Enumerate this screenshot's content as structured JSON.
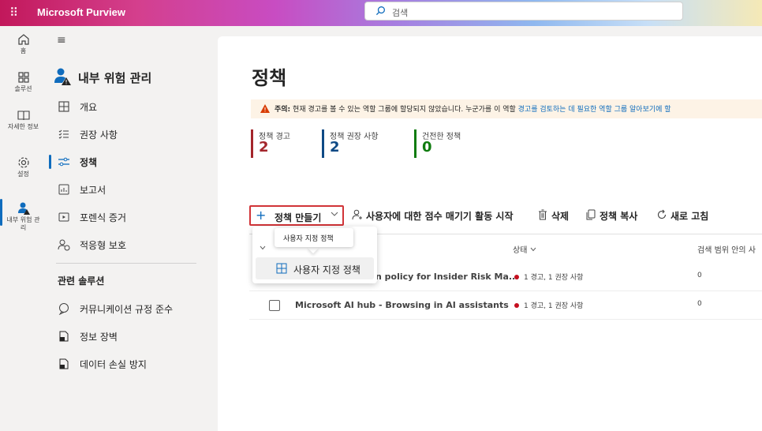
{
  "topbar": {
    "app_title": "Microsoft Purview",
    "search_placeholder": "검색"
  },
  "rail": {
    "items": [
      {
        "label": "홈",
        "icon": "home-icon"
      },
      {
        "label": "솔루션",
        "icon": "solutions-icon"
      },
      {
        "label": "자세한 정보",
        "icon": "learn-icon"
      },
      {
        "label": "설정",
        "icon": "settings-icon"
      },
      {
        "label": "내부 위험 관리",
        "icon": "insider-risk-icon"
      }
    ]
  },
  "nav": {
    "title": "내부 위험 관리",
    "items": [
      {
        "label": "개요",
        "icon": "overview-icon"
      },
      {
        "label": "권장 사항",
        "icon": "recommendations-icon"
      },
      {
        "label": "정책",
        "icon": "policies-icon"
      },
      {
        "label": "보고서",
        "icon": "reports-icon"
      },
      {
        "label": "포렌식 증거",
        "icon": "forensic-icon"
      },
      {
        "label": "적응형 보호",
        "icon": "adaptive-protection-icon"
      }
    ],
    "related_title": "관련 솔루션",
    "related": [
      {
        "label": "커뮤니케이션 규정 준수",
        "icon": "communication-icon"
      },
      {
        "label": "정보 장벽",
        "icon": "barrier-icon"
      },
      {
        "label": "데이터 손실 방지",
        "icon": "dlp-icon"
      }
    ]
  },
  "main": {
    "title": "정책",
    "warning": {
      "prefix": "주의:",
      "text": " 현재 경고를 볼 수 있는 역할 그룹에 할당되지 않았습니다. 누군가를 이 역할 ",
      "link": "경고를 검토하는 데 필요한 역할 그룹 알아보기에 할"
    },
    "stats": [
      {
        "label": "정책 경고",
        "value": "2",
        "color": "#a4262c"
      },
      {
        "label": "정책 권장 사항",
        "value": "2",
        "color": "#0f4a85"
      },
      {
        "label": "건전한 정책",
        "value": "0",
        "color": "#107c10"
      }
    ],
    "toolbar": {
      "create": "정책 만들기",
      "start_scoring": "사용자에 대한 점수 매기기 활동 시작",
      "delete": "삭제",
      "copy": "정책 복사",
      "refresh": "새로 고침"
    },
    "columns": {
      "status": "상태",
      "scope": "검색 범위 안의 사"
    },
    "rows": [
      {
        "name": "Microsoft AI hub - Detection policy for Insider Risk Management",
        "name_visible": "n policy for Insider Risk Ma...",
        "status": "1 경고, 1 권장 사항",
        "count": "0"
      },
      {
        "name": "Microsoft AI hub - Browsing in AI assistants",
        "status": "1 경고, 1 권장 사항",
        "count": "0"
      }
    ],
    "dropdown": {
      "tooltip": "사용자 지정 정책",
      "item": "사용자 지정 정책"
    }
  }
}
